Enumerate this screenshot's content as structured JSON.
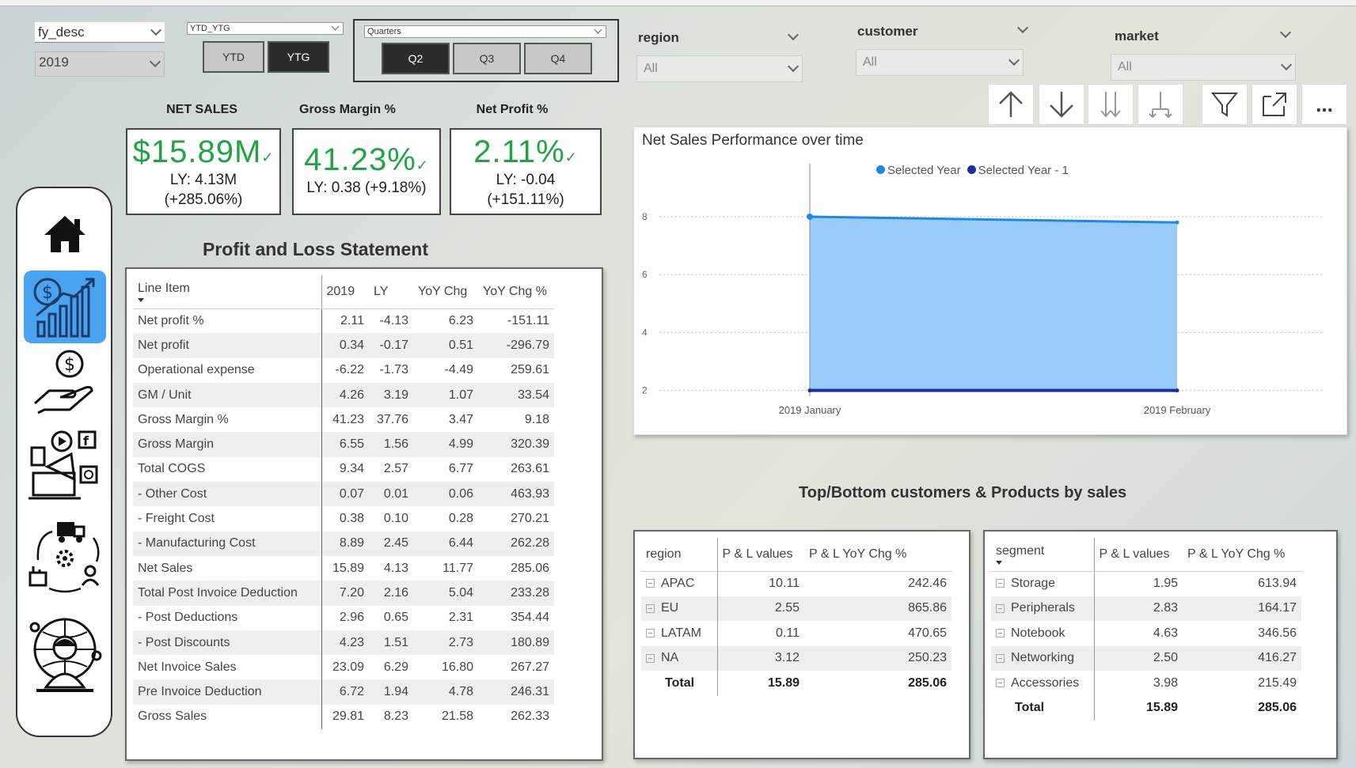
{
  "filters": {
    "fy_desc": {
      "label": "fy_desc",
      "value": "2019"
    },
    "ytd_ytg": {
      "label": "YTD_YTG",
      "buttons": [
        "YTD",
        "YTG"
      ],
      "active": "YTG"
    },
    "quarters": {
      "label": "Quarters",
      "buttons": [
        "Q2",
        "Q3",
        "Q4"
      ],
      "active": "Q2"
    },
    "region": {
      "label": "region",
      "value": "All"
    },
    "customer": {
      "label": "customer",
      "value": "All"
    },
    "market": {
      "label": "market",
      "value": "All"
    }
  },
  "toolbar": {
    "icons": [
      "arrow-up-icon",
      "arrow-down-icon",
      "double-arrow-down-icon",
      "expand-hierarchy-icon",
      "filter-icon",
      "focus-mode-icon",
      "more-options-icon"
    ],
    "more_label": "..."
  },
  "kpis": [
    {
      "title": "NET SALES",
      "value": "$15.89M",
      "ly": "LY: 4.13M",
      "chg": "(+285.06%)"
    },
    {
      "title": "Gross Margin %",
      "value": "41.23%",
      "ly": "LY: 0.38 (+9.18%)",
      "chg": ""
    },
    {
      "title": "Net Profit %",
      "value": "2.11%",
      "ly": "LY: -0.04",
      "chg": "(+151.11%)"
    }
  ],
  "nav": {
    "items": [
      "home-icon",
      "finance-growth-icon",
      "money-hand-icon",
      "marketing-icon",
      "supply-chain-icon",
      "global-executive-icon"
    ],
    "active": 1
  },
  "pl": {
    "title": "Profit and Loss Statement",
    "headers": [
      "Line Item",
      "2019",
      "LY",
      "YoY Chg",
      "YoY Chg %"
    ],
    "rows": [
      [
        "Net profit %",
        "2.11",
        "-4.13",
        "6.23",
        "-151.11"
      ],
      [
        "Net profit",
        "0.34",
        "-0.17",
        "0.51",
        "-296.79"
      ],
      [
        "Operational expense",
        "-6.22",
        "-1.73",
        "-4.49",
        "259.61"
      ],
      [
        "GM / Unit",
        "4.26",
        "3.19",
        "1.07",
        "33.54"
      ],
      [
        "Gross Margin %",
        "41.23",
        "37.76",
        "3.47",
        "9.18"
      ],
      [
        "Gross Margin",
        "6.55",
        "1.56",
        "4.99",
        "320.39"
      ],
      [
        "Total COGS",
        "9.34",
        "2.57",
        "6.77",
        "263.61"
      ],
      [
        "- Other Cost",
        "0.07",
        "0.01",
        "0.06",
        "463.93"
      ],
      [
        "- Freight Cost",
        "0.38",
        "0.10",
        "0.28",
        "270.21"
      ],
      [
        "- Manufacturing Cost",
        "8.89",
        "2.45",
        "6.44",
        "262.28"
      ],
      [
        "Net Sales",
        "15.89",
        "4.13",
        "11.77",
        "285.06"
      ],
      [
        "Total Post Invoice Deduction",
        "7.20",
        "2.16",
        "5.04",
        "233.28"
      ],
      [
        "- Post Deductions",
        "2.96",
        "0.65",
        "2.31",
        "354.44"
      ],
      [
        "- Post Discounts",
        "4.23",
        "1.51",
        "2.73",
        "180.89"
      ],
      [
        "Net Invoice Sales",
        "23.09",
        "6.29",
        "16.80",
        "267.27"
      ],
      [
        "Pre Invoice Deduction",
        "6.72",
        "1.94",
        "4.78",
        "246.31"
      ],
      [
        "Gross Sales",
        "29.81",
        "8.23",
        "21.58",
        "262.33"
      ]
    ]
  },
  "chart_data": {
    "type": "area",
    "title": "Net Sales Performance over time",
    "x": [
      "2019 January",
      "2019 February"
    ],
    "series": [
      {
        "name": "Selected Year",
        "values": [
          8.0,
          7.8
        ],
        "color": "#1e88e5"
      },
      {
        "name": "Selected Year - 1",
        "values": [
          2.0,
          2.0
        ],
        "color": "#1a2fa0"
      }
    ],
    "ylim": [
      1.8,
      8.9
    ],
    "yticks": [
      "2",
      "4",
      "6",
      "8"
    ],
    "legend": "top-center",
    "grid": true
  },
  "topbottom": {
    "title": "Top/Bottom customers & Products by sales",
    "region_table": {
      "headers": [
        "region",
        "P & L values",
        "P & L YoY Chg %"
      ],
      "rows": [
        [
          "APAC",
          "10.11",
          "242.46"
        ],
        [
          "EU",
          "2.55",
          "865.86"
        ],
        [
          "LATAM",
          "0.11",
          "470.65"
        ],
        [
          "NA",
          "3.12",
          "250.23"
        ]
      ],
      "total": [
        "Total",
        "15.89",
        "285.06"
      ]
    },
    "segment_table": {
      "headers": [
        "segment",
        "P & L values",
        "P & L YoY Chg %"
      ],
      "rows": [
        [
          "Storage",
          "1.95",
          "613.94"
        ],
        [
          "Peripherals",
          "2.83",
          "164.17"
        ],
        [
          "Notebook",
          "4.63",
          "346.56"
        ],
        [
          "Networking",
          "2.50",
          "416.27"
        ],
        [
          "Accessories",
          "3.98",
          "215.49"
        ]
      ],
      "total": [
        "Total",
        "15.89",
        "285.06"
      ]
    }
  }
}
